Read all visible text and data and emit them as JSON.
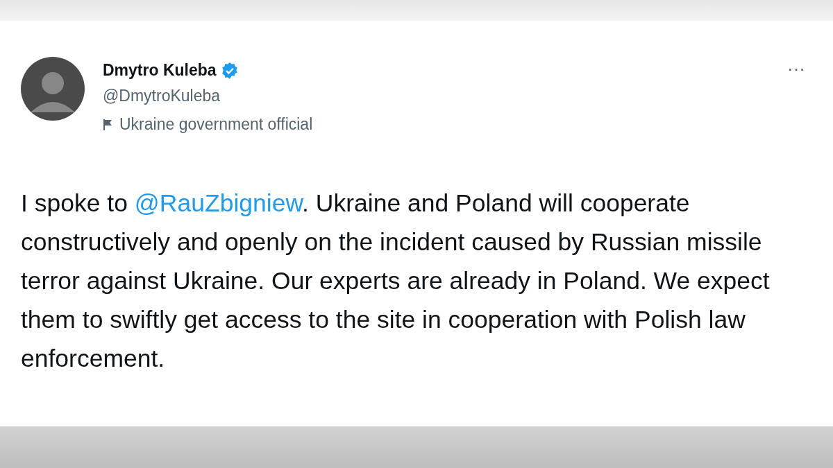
{
  "tweet": {
    "author": {
      "name": "Dmytro Kuleba",
      "verified": true,
      "handle": "@DmytroKuleba",
      "label": "Ukraine government official"
    },
    "text_before": "I spoke to ",
    "mention": "@RauZbigniew",
    "text_after": ". Ukraine and Poland will cooperate constructively and openly on the incident caused by Russian missile terror against Ukraine. Our experts are already in Poland. We expect them to swiftly get access to the site in cooperation with Polish law enforcement.",
    "more_menu": "···"
  }
}
